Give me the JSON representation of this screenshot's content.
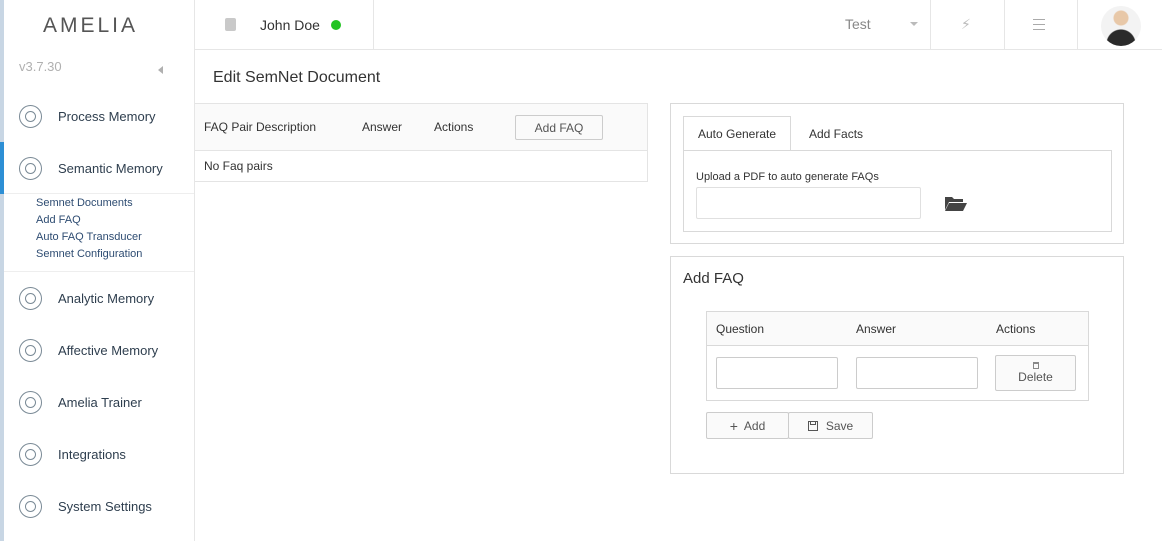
{
  "app": {
    "logo": "AMELIA",
    "version": "v3.7.30"
  },
  "sidebar": {
    "items": [
      {
        "label": "Process Memory",
        "icon": "process-memory-icon"
      },
      {
        "label": "Semantic Memory",
        "icon": "semantic-memory-icon",
        "active": true
      },
      {
        "label": "Analytic Memory",
        "icon": "analytic-memory-icon"
      },
      {
        "label": "Affective Memory",
        "icon": "affective-memory-icon"
      },
      {
        "label": "Amelia Trainer",
        "icon": "amelia-trainer-icon"
      },
      {
        "label": "Integrations",
        "icon": "integrations-icon"
      },
      {
        "label": "System Settings",
        "icon": "system-settings-icon"
      }
    ],
    "submenu": [
      "Semnet Documents",
      "Add FAQ",
      "Auto FAQ Transducer",
      "Semnet Configuration"
    ]
  },
  "topbar": {
    "user_name": "John Doe",
    "status": "online",
    "env_selected": "Test",
    "status_color": "#22c322"
  },
  "page": {
    "title": "Edit SemNet Document",
    "faq_table": {
      "headers": [
        "FAQ Pair Description",
        "Answer",
        "Actions"
      ],
      "add_button": "Add FAQ",
      "empty_text": "No Faq pairs"
    },
    "tabs": [
      "Auto Generate",
      "Add Facts"
    ],
    "upload_label": "Upload a PDF to auto generate FAQs",
    "add_faq": {
      "title": "Add FAQ",
      "headers": [
        "Question",
        "Answer",
        "Actions"
      ],
      "question_value": "",
      "answer_value": "",
      "delete_label": "Delete",
      "add_label": "Add",
      "save_label": "Save"
    }
  },
  "colors": {
    "accent": "#2d8fd5"
  }
}
